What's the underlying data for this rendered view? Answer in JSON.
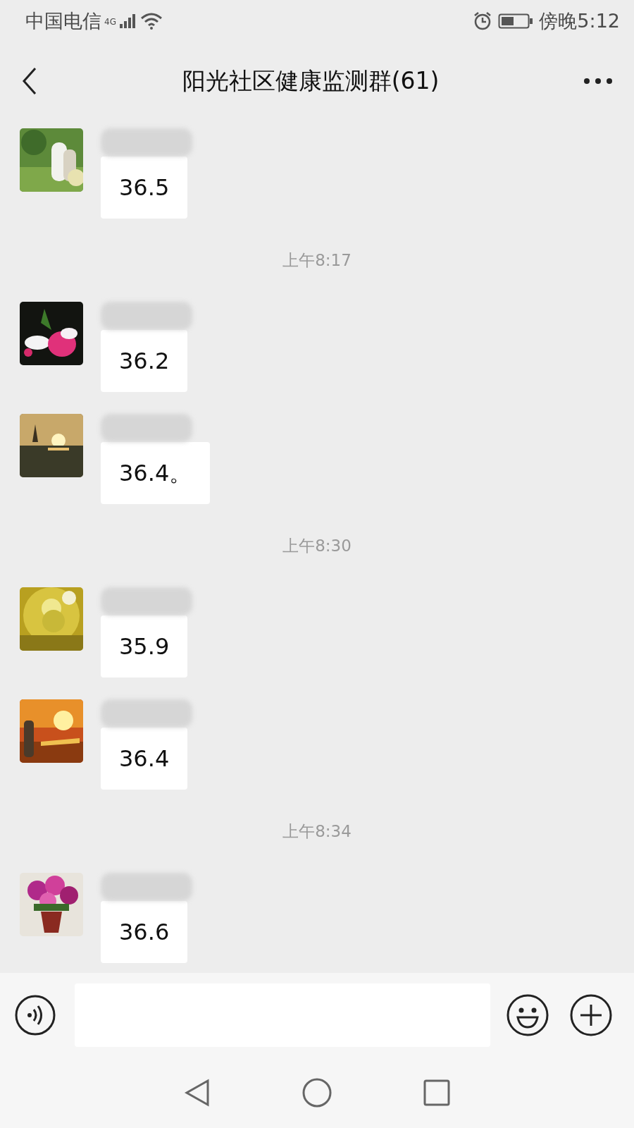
{
  "status_bar": {
    "carrier": "中国电信",
    "network": "4G",
    "time": "傍晚5:12"
  },
  "title_bar": {
    "title": "阳光社区健康监测群(61)"
  },
  "chat": [
    {
      "kind": "message",
      "text": "36.5"
    },
    {
      "kind": "time",
      "text": "上午8:17"
    },
    {
      "kind": "message",
      "text": "36.2"
    },
    {
      "kind": "message",
      "text": "36.4。"
    },
    {
      "kind": "time",
      "text": "上午8:30"
    },
    {
      "kind": "message",
      "text": "35.9"
    },
    {
      "kind": "message",
      "text": "36.4"
    },
    {
      "kind": "time",
      "text": "上午8:34"
    },
    {
      "kind": "message",
      "text": "36.6"
    }
  ]
}
